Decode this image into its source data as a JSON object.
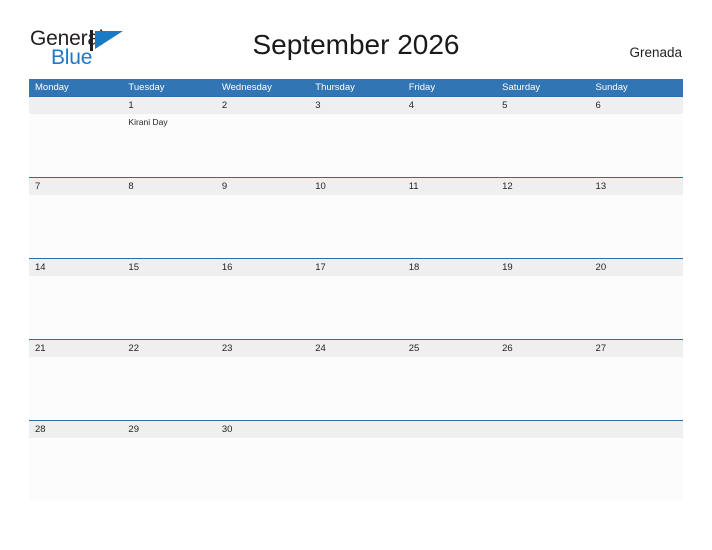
{
  "brand": {
    "name_part1": "General",
    "name_part2": "Blue",
    "flag_color": "#1a7ac4",
    "text_color": "#231f20",
    "blue_text_color": "#2079c8"
  },
  "header": {
    "title": "September 2026",
    "locale": "Grenada"
  },
  "theme": {
    "header_blue": "#3275b5",
    "rule_blue": "#2b6cad",
    "date_band": "#efefef",
    "cell_background": "#fcfcfc"
  },
  "weekdays": [
    "Monday",
    "Tuesday",
    "Wednesday",
    "Thursday",
    "Friday",
    "Saturday",
    "Sunday"
  ],
  "weeks": [
    {
      "days": [
        {
          "date": "",
          "events": []
        },
        {
          "date": "1",
          "events": [
            "Kirani Day"
          ]
        },
        {
          "date": "2",
          "events": []
        },
        {
          "date": "3",
          "events": []
        },
        {
          "date": "4",
          "events": []
        },
        {
          "date": "5",
          "events": []
        },
        {
          "date": "6",
          "events": []
        }
      ]
    },
    {
      "days": [
        {
          "date": "7",
          "events": []
        },
        {
          "date": "8",
          "events": []
        },
        {
          "date": "9",
          "events": []
        },
        {
          "date": "10",
          "events": []
        },
        {
          "date": "11",
          "events": []
        },
        {
          "date": "12",
          "events": []
        },
        {
          "date": "13",
          "events": []
        }
      ]
    },
    {
      "days": [
        {
          "date": "14",
          "events": []
        },
        {
          "date": "15",
          "events": []
        },
        {
          "date": "16",
          "events": []
        },
        {
          "date": "17",
          "events": []
        },
        {
          "date": "18",
          "events": []
        },
        {
          "date": "19",
          "events": []
        },
        {
          "date": "20",
          "events": []
        }
      ]
    },
    {
      "days": [
        {
          "date": "21",
          "events": []
        },
        {
          "date": "22",
          "events": []
        },
        {
          "date": "23",
          "events": []
        },
        {
          "date": "24",
          "events": []
        },
        {
          "date": "25",
          "events": []
        },
        {
          "date": "26",
          "events": []
        },
        {
          "date": "27",
          "events": []
        }
      ]
    },
    {
      "days": [
        {
          "date": "28",
          "events": []
        },
        {
          "date": "29",
          "events": []
        },
        {
          "date": "30",
          "events": []
        },
        {
          "date": "",
          "events": []
        },
        {
          "date": "",
          "events": []
        },
        {
          "date": "",
          "events": []
        },
        {
          "date": "",
          "events": []
        }
      ]
    }
  ]
}
